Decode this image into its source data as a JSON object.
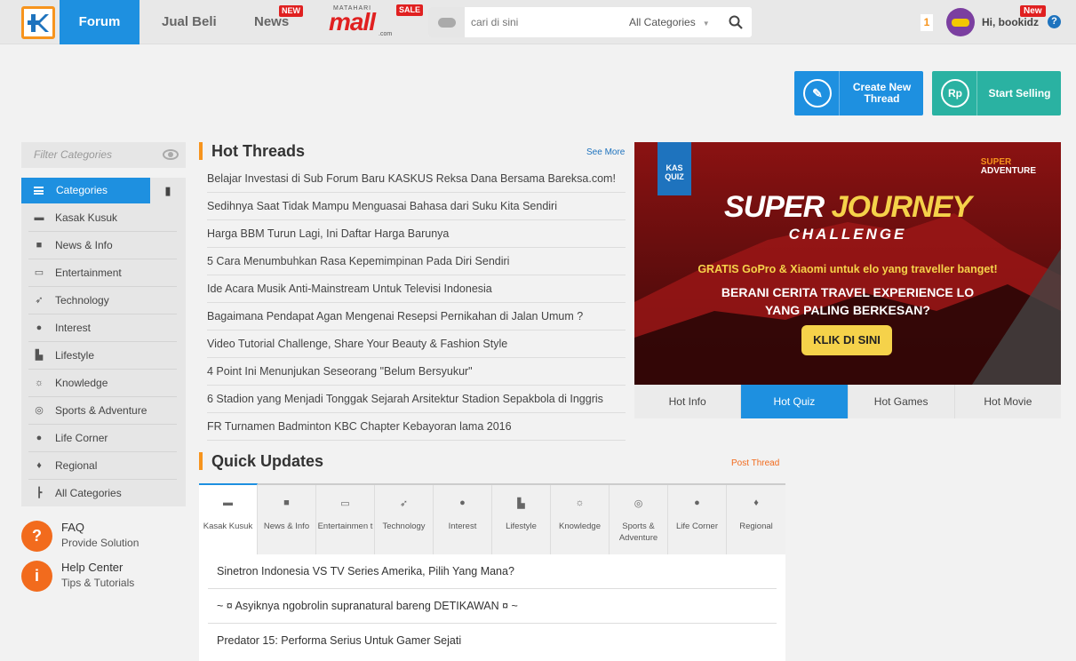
{
  "topnav": {
    "forum": "Forum",
    "jual_beli": "Jual Beli",
    "news": "News",
    "news_badge": "NEW",
    "mall_top": "MATAHARI",
    "mall_name": "mall",
    "mall_dotcom": ".com",
    "mall_badge": "SALE"
  },
  "search": {
    "placeholder": "cari di sini",
    "category": "All Categories"
  },
  "user": {
    "notif_count": "1",
    "greeting": "Hi, bookidz",
    "new_badge": "New"
  },
  "actions": {
    "create_thread": "Create New Thread",
    "start_selling": "Start Selling",
    "rp_symbol": "Rp"
  },
  "sidebar": {
    "filter_placeholder": "Filter Categories",
    "categories_header": "Categories",
    "items": [
      {
        "label": "Kasak Kusuk",
        "icon": "chat-icon"
      },
      {
        "label": "News & Info",
        "icon": "briefcase-icon"
      },
      {
        "label": "Entertainment",
        "icon": "tv-icon"
      },
      {
        "label": "Technology",
        "icon": "rocket-icon"
      },
      {
        "label": "Interest",
        "icon": "palette-icon"
      },
      {
        "label": "Lifestyle",
        "icon": "hat-icon"
      },
      {
        "label": "Knowledge",
        "icon": "bulb-icon"
      },
      {
        "label": "Sports & Adventure",
        "icon": "compass-icon"
      },
      {
        "label": "Life Corner",
        "icon": "apple-icon"
      },
      {
        "label": "Regional",
        "icon": "pin-icon"
      },
      {
        "label": "All Categories",
        "icon": "tree-icon"
      }
    ],
    "faq_title": "FAQ",
    "faq_sub": "Provide Solution",
    "help_title": "Help Center",
    "help_sub": "Tips & Tutorials"
  },
  "hot_threads": {
    "title": "Hot Threads",
    "see_more": "See More",
    "items": [
      "Belajar Investasi di Sub Forum Baru KASKUS Reksa Dana Bersama Bareksa.com!",
      "Sedihnya Saat Tidak Mampu Menguasai Bahasa dari Suku Kita Sendiri",
      "Harga BBM Turun Lagi, Ini Daftar Harga Barunya",
      "5 Cara Menumbuhkan Rasa Kepemimpinan Pada Diri Sendiri",
      "Ide Acara Musik Anti-Mainstream Untuk Televisi Indonesia",
      "Bagaimana Pendapat Agan Mengenai Resepsi Pernikahan di Jalan Umum ?",
      "Video Tutorial Challenge, Share Your Beauty & Fashion Style",
      "4 Point Ini Menunjukan Seseorang \"Belum Bersyukur\"",
      "6 Stadion yang Menjadi Tonggak Sejarah Arsitektur Stadion Sepakbola di Inggris",
      "FR Turnamen Badminton KBC Chapter Kebayoran lama 2016"
    ]
  },
  "banner": {
    "kas_quiz": "KAS QUIZ",
    "brand_top": "SUPER",
    "brand_bottom": "ADVENTURE",
    "title_a": "SUPER ",
    "title_b": "JOURNEY",
    "subtitle": "CHALLENGE",
    "promo": "GRATIS GoPro & Xiaomi untuk elo yang traveller banget!",
    "question_1": "BERANI CERITA TRAVEL EXPERIENCE LO",
    "question_2": "YANG PALING BERKESAN?",
    "cta": "KLIK DI SINI"
  },
  "hot_tabs": [
    "Hot Info",
    "Hot Quiz",
    "Hot Games",
    "Hot Movie"
  ],
  "quick_updates": {
    "title": "Quick Updates",
    "post_thread": "Post Thread",
    "tabs": [
      {
        "label": "Kasak Kusuk",
        "icon": "chat-icon"
      },
      {
        "label": "News & Info",
        "icon": "briefcase-icon"
      },
      {
        "label": "Entertainmen t",
        "icon": "tv-icon"
      },
      {
        "label": "Technology",
        "icon": "rocket-icon"
      },
      {
        "label": "Interest",
        "icon": "palette-icon"
      },
      {
        "label": "Lifestyle",
        "icon": "hat-icon"
      },
      {
        "label": "Knowledge",
        "icon": "bulb-icon"
      },
      {
        "label": "Sports & Adventure",
        "icon": "compass-icon"
      },
      {
        "label": "Life Corner",
        "icon": "apple-icon"
      },
      {
        "label": "Regional",
        "icon": "pin-icon"
      }
    ],
    "items": [
      "Sinetron Indonesia VS TV Series Amerika, Pilih Yang Mana?",
      "~ ¤ Asyiknya ngobrolin supranatural bareng DETIKAWAN ¤ ~",
      "Predator 15: Performa Serius Untuk Gamer Sejati"
    ]
  },
  "colors": {
    "primary": "#1e90e0",
    "accent": "#f7941d",
    "sell": "#2ab2a2",
    "faq": "#f26b1d"
  }
}
